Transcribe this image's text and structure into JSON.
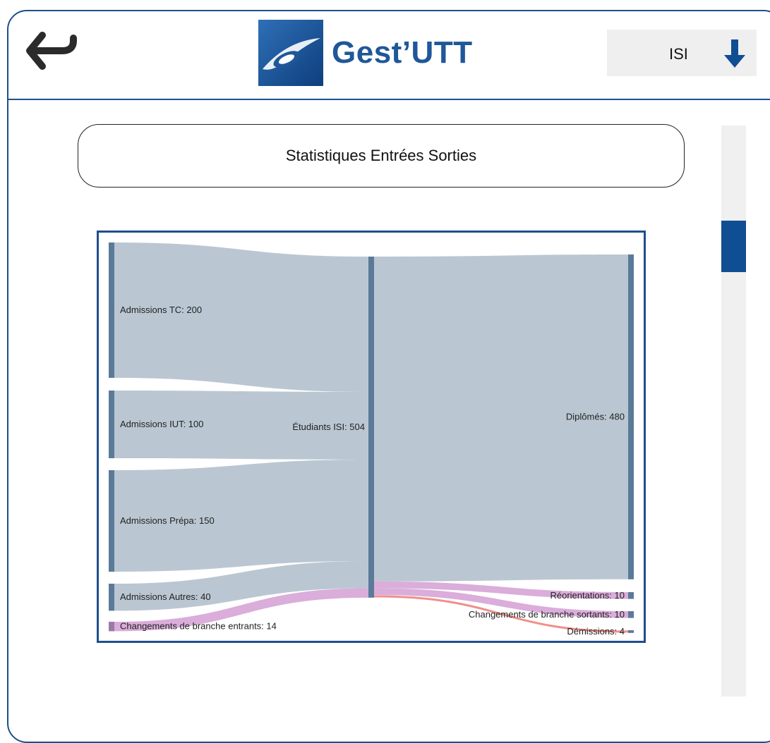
{
  "header": {
    "app_title": "Gest’UTT",
    "selector": {
      "value": "ISI"
    }
  },
  "page": {
    "title": "Statistiques Entrées Sorties"
  },
  "colors": {
    "accent": "#1e4f8c",
    "node": "#5b7a99",
    "flow": "#b6c4d0",
    "flow_change": "#d8a9d8",
    "flow_quit": "#f08f8a"
  },
  "icons": {
    "back": "return-arrow-icon",
    "dropdown": "arrow-down-icon",
    "logo": "utt-logo-icon"
  },
  "chart_data": {
    "type": "sankey",
    "nodes": [
      {
        "id": "tc",
        "label": "Admissions TC: 200",
        "value": 200
      },
      {
        "id": "iut",
        "label": "Admissions IUT: 100",
        "value": 100
      },
      {
        "id": "prepa",
        "label": "Admissions Prépa: 150",
        "value": 150
      },
      {
        "id": "autres",
        "label": "Admissions Autres: 40",
        "value": 40
      },
      {
        "id": "chg_in",
        "label": "Changements de branche entrants: 14",
        "value": 14
      },
      {
        "id": "isi",
        "label": "Étudiants ISI: 504",
        "value": 504
      },
      {
        "id": "dipl",
        "label": "Diplômés: 480",
        "value": 480
      },
      {
        "id": "reor",
        "label": "Réorientations: 10",
        "value": 10
      },
      {
        "id": "chg_out",
        "label": "Changements de branche sortants: 10",
        "value": 10
      },
      {
        "id": "dem",
        "label": "Démissions: 4",
        "value": 4
      }
    ],
    "links": [
      {
        "source": "tc",
        "target": "isi",
        "value": 200
      },
      {
        "source": "iut",
        "target": "isi",
        "value": 100
      },
      {
        "source": "prepa",
        "target": "isi",
        "value": 150
      },
      {
        "source": "autres",
        "target": "isi",
        "value": 40
      },
      {
        "source": "chg_in",
        "target": "isi",
        "value": 14
      },
      {
        "source": "isi",
        "target": "dipl",
        "value": 480
      },
      {
        "source": "isi",
        "target": "reor",
        "value": 10
      },
      {
        "source": "isi",
        "target": "chg_out",
        "value": 10
      },
      {
        "source": "isi",
        "target": "dem",
        "value": 4
      }
    ]
  }
}
